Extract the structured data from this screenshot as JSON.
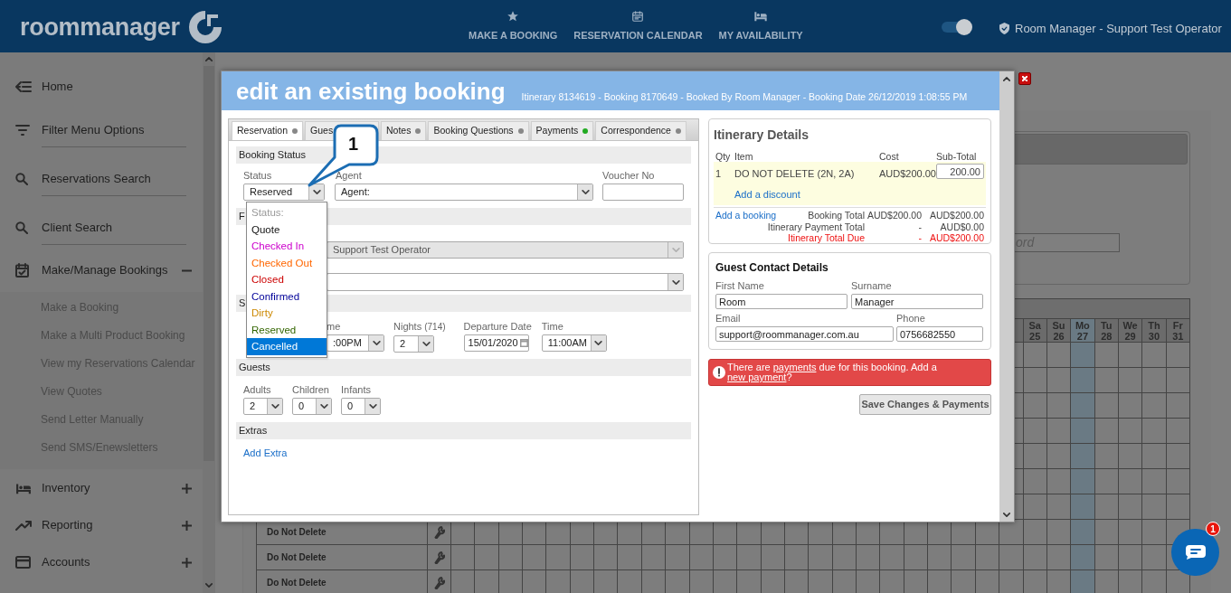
{
  "top_bar": {
    "logo": "roommanager",
    "nav": [
      {
        "label": "MAKE A BOOKING"
      },
      {
        "label": "RESERVATION CALENDAR"
      },
      {
        "label": "MY AVAILABILITY"
      }
    ],
    "toggle": {
      "on": true
    },
    "user": "Room Manager - Support Test Operator"
  },
  "sidebar": {
    "items": [
      {
        "label": "Home",
        "kind": "link"
      },
      {
        "label": "Filter Menu Options",
        "kind": "field"
      },
      {
        "label": "Reservations Search",
        "kind": "field"
      },
      {
        "label": "Client Search",
        "kind": "field"
      },
      {
        "label": "Make/Manage Bookings",
        "kind": "group",
        "expanded": true,
        "children": [
          {
            "label": "Make a Booking"
          },
          {
            "label": "Make a Multi Product Booking"
          },
          {
            "label": "View my Reservations Calendar"
          },
          {
            "label": "View Quotes"
          },
          {
            "label": "Send Letter Manually"
          },
          {
            "label": "Send SMS/Enewsletters"
          }
        ]
      },
      {
        "label": "Inventory",
        "kind": "group",
        "expanded": false
      },
      {
        "label": "Reporting",
        "kind": "group",
        "expanded": false
      },
      {
        "label": "Accounts",
        "kind": "group",
        "expanded": false
      }
    ]
  },
  "background": {
    "search_placeholder": "ord",
    "calendar": {
      "days": [
        {
          "day": "Sa",
          "date": "25",
          "today": false
        },
        {
          "day": "Su",
          "date": "26",
          "today": false
        },
        {
          "day": "Mo",
          "date": "27",
          "today": true
        },
        {
          "day": "Tu",
          "date": "28",
          "today": false
        },
        {
          "day": "We",
          "date": "29",
          "today": false
        },
        {
          "day": "Th",
          "date": "30",
          "today": false
        },
        {
          "day": "Fr",
          "date": "31",
          "today": false
        }
      ],
      "rows": [
        {
          "label": "Do Not Delete"
        },
        {
          "label": "Do Not Delete"
        },
        {
          "label": "Do Not Delete"
        }
      ]
    }
  },
  "modal": {
    "title": "edit an existing booking",
    "subtitle": "Itinerary 8134619 - Booking 8170649 - Booked By Room Manager - Booking Date 26/12/2019 1:08:55 PM",
    "tabs": [
      {
        "label": "Reservation",
        "selected": true,
        "color": "#888888"
      },
      {
        "label": "Gues",
        "selected": false
      },
      {
        "label": "Notes",
        "selected": false,
        "color": "#888888"
      },
      {
        "label": "Booking Questions",
        "selected": false,
        "color": "#888888"
      },
      {
        "label": "Payments",
        "selected": false,
        "color": "#22aa22"
      },
      {
        "label": "Correspondence",
        "selected": false,
        "color": "#888888"
      }
    ],
    "booking_status": {
      "heading": "Booking Status",
      "status": {
        "label": "Status",
        "value": "Reserved"
      },
      "agent": {
        "label": "Agent",
        "value": "Agent:"
      },
      "voucher": {
        "label": "Voucher No"
      }
    },
    "section_2": {
      "heading": "F",
      "selects": [
        {
          "value": "Support Test Operator",
          "disabled": true
        },
        {
          "disabled": false
        }
      ]
    },
    "section_3": {
      "heading": "S",
      "fields": [
        {
          "label": "me",
          "value": ":00PM",
          "kind": "select"
        },
        {
          "label": "Nights",
          "note": "(714)",
          "value": "2",
          "kind": "select"
        },
        {
          "label": "Departure Date",
          "value": "15/01/2020",
          "kind": "date"
        },
        {
          "label": "Time",
          "value": "11:00AM",
          "kind": "select"
        }
      ]
    },
    "guests": {
      "heading": "Guests",
      "fields": [
        {
          "label": "Adults",
          "value": "2"
        },
        {
          "label": "Children",
          "value": "0"
        },
        {
          "label": "Infants",
          "value": "0"
        }
      ]
    },
    "extras": {
      "heading": "Extras",
      "link": "Add Extra"
    },
    "status_dropdown": {
      "options": [
        {
          "label": "Status:",
          "color": "#999999",
          "selected": false
        },
        {
          "label": "Quote",
          "selected": false
        },
        {
          "label": "Checked In",
          "color": "#cc00cc",
          "selected": false
        },
        {
          "label": "Checked Out",
          "color": "#ff6600",
          "selected": false
        },
        {
          "label": "Closed",
          "color": "#cc0000",
          "selected": false
        },
        {
          "label": "Confirmed",
          "color": "#000099",
          "selected": false
        },
        {
          "label": "Dirty",
          "color": "#cc8800",
          "selected": false
        },
        {
          "label": "Reserved",
          "color": "#336600",
          "selected": false
        },
        {
          "label": "Cancelled",
          "selected": true
        }
      ]
    },
    "callout": "1",
    "itinerary": {
      "title": "Itinerary Details",
      "columns": [
        "Qty",
        "Item",
        "Cost",
        "Sub-Total"
      ],
      "items": [
        {
          "qty": "1",
          "item": "DO NOT DELETE (2N, 2A)",
          "cost": "AUD$200.00",
          "subtotal": "200.00",
          "discount_link": "Add a discount"
        }
      ],
      "add_link": "Add a booking",
      "totals": [
        {
          "label": "Booking Total",
          "cost": "AUD$200.00",
          "subtotal": "AUD$200.00",
          "kind": "normal"
        },
        {
          "label": "Itinerary Payment Total",
          "cost": "-",
          "subtotal": "AUD$0.00",
          "kind": "normal"
        },
        {
          "label": "Itinerary Total Due",
          "cost": "-",
          "subtotal": "AUD$200.00",
          "kind": "due"
        }
      ]
    },
    "guest_contact": {
      "title": "Guest Contact Details",
      "fields": [
        {
          "label": "First Name",
          "value": "Room"
        },
        {
          "label": "Surname",
          "value": "Manager"
        },
        {
          "label": "Email",
          "value": "support@roommanager.com.au"
        },
        {
          "label": "Phone",
          "value": "0756682550"
        }
      ]
    },
    "alert": {
      "parts": [
        {
          "text": "There are "
        },
        {
          "text": "payments",
          "link": true
        },
        {
          "text": " due for this booking. Add a "
        },
        {
          "text": "new payment",
          "link": true
        },
        {
          "text": "?"
        }
      ]
    },
    "save_button": "Save Changes & Payments"
  },
  "chat": {
    "badge": "1"
  }
}
